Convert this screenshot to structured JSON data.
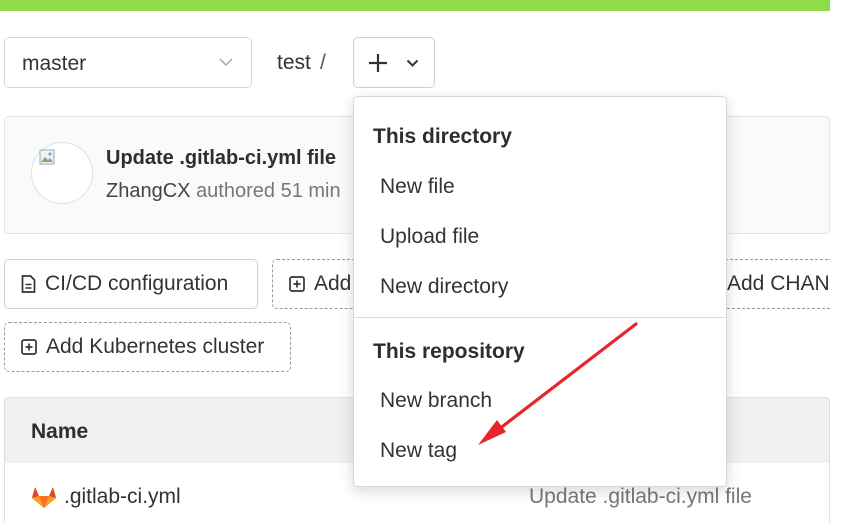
{
  "branch_selector": {
    "value": "master"
  },
  "breadcrumb": {
    "folder": "test",
    "separator": "/"
  },
  "last_commit": {
    "title": "Update .gitlab-ci.yml file",
    "author": "ZhangCX",
    "meta": "authored 51 min"
  },
  "actions": {
    "cicd_label": "CI/CD configuration",
    "add_partial_label": "Add",
    "add_changelog_partial_label": "Add CHAN",
    "add_k8s_label": "Add Kubernetes cluster"
  },
  "dropdown": {
    "section1_header": "This directory",
    "new_file": "New file",
    "upload_file": "Upload file",
    "new_directory": "New directory",
    "section2_header": "This repository",
    "new_branch": "New branch",
    "new_tag": "New tag"
  },
  "table": {
    "name_header": "Name",
    "rows": [
      {
        "name": ".gitlab-ci.yml",
        "last_commit": "Update .gitlab-ci.yml file"
      }
    ]
  },
  "colors": {
    "topbar": "#8fdc48",
    "annotation_arrow": "#e8252a",
    "gitlab_orange": "#e24329"
  }
}
